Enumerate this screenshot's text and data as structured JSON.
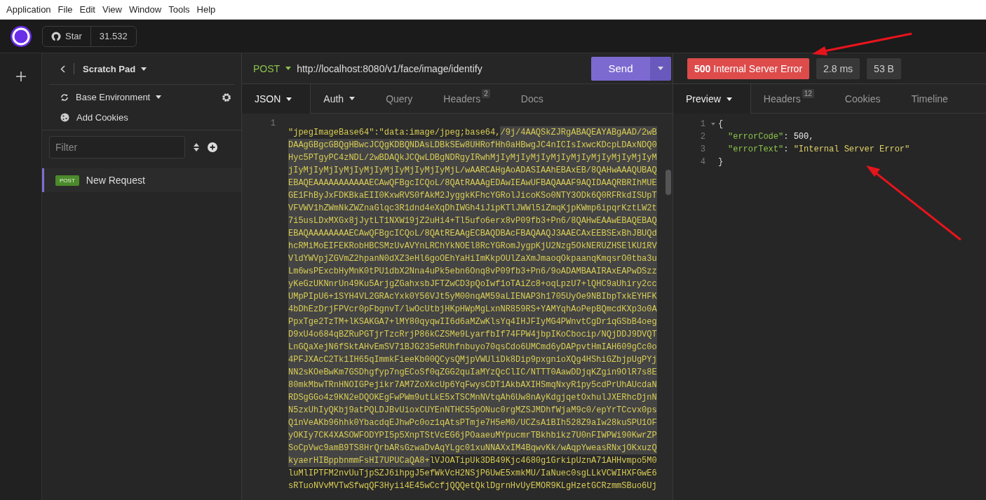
{
  "menu": [
    "Application",
    "File",
    "Edit",
    "View",
    "Window",
    "Tools",
    "Help"
  ],
  "github": {
    "label": "Star",
    "count": "31.532"
  },
  "sidebar": {
    "title": "Scratch Pad",
    "environment": "Base Environment",
    "cookies": "Add Cookies",
    "filter_placeholder": "Filter",
    "requests": [
      {
        "method": "POST",
        "name": "New Request",
        "selected": true
      }
    ]
  },
  "request": {
    "method": "POST",
    "url": "http://localhost:8080/v1/face/image/identify",
    "send": "Send",
    "tabs": [
      {
        "label": "JSON",
        "dropdown": true,
        "selected": true
      },
      {
        "label": "Auth",
        "dropdown": true,
        "selected": false
      },
      {
        "label": "Query",
        "dropdown": false,
        "selected": false
      },
      {
        "label": "Headers",
        "dropdown": false,
        "badge": "2",
        "selected": false
      },
      {
        "label": "Docs",
        "dropdown": false,
        "selected": false
      }
    ],
    "body": {
      "line_number": "1",
      "lines": [
        [
          {
            "text": "\"jpegImageBase64\":\"data:image/jpeg;base64,",
            "selected": false
          },
          {
            "text": "/9j/4AAQSkZJRgABAQEAYABgAAD/2wB",
            "selected": true
          }
        ],
        [
          {
            "text": "DAAgGBgcGBQgHBwcJCQgKDBQNDAsLDBkSEw8UHRofHh0aHBwgJC4nICIsIxwcKDcpLDAxNDQ0",
            "selected": true
          }
        ],
        [
          {
            "text": "Hyc5PTgyPC4zNDL/2wBDAQkJCQwLDBgNDRgyIRwhMjIyMjIyMjIyMjIyMjIyMjIyMjIyMjIyM",
            "selected": true
          }
        ],
        [
          {
            "text": "jIyMjIyMjIyMjIyMjIyMjIyMjIyMjIyMjL/wAARCAHgAoADASIAAhEBAxEB/8QAHwAAAQUBAQ",
            "selected": true
          }
        ],
        [
          {
            "text": "EBAQEAAAAAAAAAAAECAwQFBgcICQoL/8QAtRAAAgEDAwIEAwUFBAQAAAF9AQIDAAQRBRIhMUE",
            "selected": true
          }
        ],
        [
          {
            "text": "GE1FhByJxFDKBkaEII0KxwRVS0fAkM2JyggkKFhcYGRolJicoKSo0NTY3ODk6Q0RFRkdISUpT",
            "selected": true
          }
        ],
        [
          {
            "text": "VFVWV1hZWmNkZWZnaGlqc3R1dnd4eXqDhIWGh4iJipKTlJWWl5iZmqKjpKWmp6ipqrKztLW2t",
            "selected": true
          }
        ],
        [
          {
            "text": "7i5usLDxMXGx8jJytLT1NXW19jZ2uHi4+Tl5ufo6erx8vP09fb3+Pn6/8QAHwEAAwEBAQEBAQ",
            "selected": true
          }
        ],
        [
          {
            "text": "EBAQAAAAAAAAECAwQFBgcICQoL/8QAtREAAgECBAQDBAcFBAQAAQJ3AAECAxEEBSExBhJBUQd",
            "selected": true
          }
        ],
        [
          {
            "text": "hcRMiMoEIFEKRobHBCSMzUvAVYnLRChYkNOEl8RcYGRomJygpKjU2Nzg5OkNERUZHSElKU1RV",
            "selected": true
          }
        ],
        [
          {
            "text": "VldYWVpjZGVmZ2hpanN0dXZ3eHl6goOEhYaHiImKkpOUlZaXmJmaoqOkpaanqKmqsrO0tba3u",
            "selected": true
          }
        ],
        [
          {
            "text": "Lm6wsPExcbHyMnK0tPU1dbX2Nna4uPk5ebn6Onq8vP09fb3+Pn6/9oADAMBAAIRAxEAPwDSzz",
            "selected": true
          }
        ],
        [
          {
            "text": "yKeGzUKNnrUn49Ku5ArjgZGahxsbJFTZwCD3pQoIwf1oTAiZc8+oqLpzU7+lQHC9aUhiry2cc",
            "selected": true
          }
        ],
        [
          {
            "text": "UMpPIpU6+1SYH4VL2GRAcYxk0Y56VJt5yM00nqAM59aLIENAP3h1705UyOe9NBIbpTxkEYHFK",
            "selected": true
          }
        ],
        [
          {
            "text": "4bDhEzDrjFPVcr0pFbgnvT/lwOcUtbjHKpHWpMgLxnNR859RS+YAMYqhAoPepBQmcdKXp3o0A",
            "selected": true
          }
        ],
        [
          {
            "text": "PpxTge2TzTM+lKSAKGA7+lMY80qyqwII6d6aMZwKlsYq4IHJFIyMG4PWnvtCgDr1qGSbB4oeg",
            "selected": true
          }
        ],
        [
          {
            "text": "D9xU4o684qBZRuPGTjrTzcRrjP86kCZSMe9LyarfbIf74FPW4jbpIKoCbocip/NQjDDJ9DVQT",
            "selected": true
          }
        ],
        [
          {
            "text": "LnGQaXejN6fSktAHvEmSV71BJG235eRUhfnbuyo70qsCdo6UMCmd6yDAPpvtHmIAH609gCc0o",
            "selected": true
          }
        ],
        [
          {
            "text": "4PFJXAcC2Tk1IH65qImmkFieeKb00QCysQMjpVWUliDk8Dip9pxgnioXQg4HShiGZbjpUgPYj",
            "selected": true
          }
        ],
        [
          {
            "text": "NN2sKOeBwKm7GSDhgfyp7ngECoSf0qZGG2quIaMYzQcClIC/NTTT0AawDDjqKZgin9OlR7s8E",
            "selected": true
          }
        ],
        [
          {
            "text": "80mkMbwTRnHNOIGPejikr7AM7ZoXkcUp6YqFwysCDT1AkbAXIHSmqNxyR1py5cdPrUhAUcdaN",
            "selected": true
          }
        ],
        [
          {
            "text": "RDSgGGo4z9KN2eDQOKEgFwPWm9utLkE5xTSCMnNVtqAh6Uw8nAyKdgjqetOxhulJXERhcDjnN",
            "selected": true
          }
        ],
        [
          {
            "text": "N5zxUhIyQKbj9atPQLDJBvUioxCUYEnNTHC55pONuc0rgMZSJMDhfWjaM9c0/epYrTCcvx0ps",
            "selected": true
          }
        ],
        [
          {
            "text": "Q1nVeAKb96hhk0YbacdqEJhwPc0oz1qAtsPTmje7H5eM0/UCZsA1BIh528Z9aIw28kuSPU1OF",
            "selected": true
          }
        ],
        [
          {
            "text": "yOKIy7CK4XASOWFODYPI5p5XnpTStVcEG6jPOaaeuMYpucmrTBkhbikz7U0nFIWPWi90KwrZP",
            "selected": true
          }
        ],
        [
          {
            "text": "SoCpVwc9amB9TS8HrQrbARsGzwaDvAqYLgc01xuNNAXxIM4BqwvKk/wAqpYweasRNxjOKxuzQ",
            "selected": true
          }
        ],
        [
          {
            "text": "kyaerHIBppbnmmFsHI7UPUCaQA8+",
            "selected": true
          },
          {
            "text": "lVJOATipUk3DB49Kjc4680g1GrkipUznA71AHHvmpo5M0",
            "selected": false
          }
        ],
        [
          {
            "text": "luMlIPTFM2nvUuTjpSZJ6ihpgJ5efWkVcH2NSjP6UwE5xmkMU/IaNuec0sgLLkVCWIHXFGwE6",
            "selected": false
          }
        ],
        [
          {
            "text": "sRTuoNVvMVTwSfwqQF3Hyii4E45wCcfjQQQetQklDgrnHvUyEMOR9KLgHzetGCRzmmSBuo6Uj",
            "selected": false
          }
        ]
      ]
    }
  },
  "response": {
    "status_code": "500",
    "status_text": "Internal Server Error",
    "time": "2.8 ms",
    "size": "53 B",
    "tabs": [
      {
        "label": "Preview",
        "dropdown": true,
        "selected": true
      },
      {
        "label": "Headers",
        "dropdown": false,
        "badge": "12",
        "selected": false
      },
      {
        "label": "Cookies",
        "dropdown": false,
        "selected": false
      },
      {
        "label": "Timeline",
        "dropdown": false,
        "selected": false
      }
    ],
    "lines": [
      {
        "number": "1",
        "foldable": true,
        "indent": false,
        "tokens": [
          {
            "kind": "punct",
            "text": "{"
          }
        ]
      },
      {
        "number": "2",
        "foldable": false,
        "indent": true,
        "tokens": [
          {
            "kind": "key",
            "text": "\"errorCode\""
          },
          {
            "kind": "punct",
            "text": ": "
          },
          {
            "kind": "number",
            "text": "500"
          },
          {
            "kind": "punct",
            "text": ","
          }
        ]
      },
      {
        "number": "3",
        "foldable": false,
        "indent": true,
        "tokens": [
          {
            "kind": "key",
            "text": "\"errorText\""
          },
          {
            "kind": "punct",
            "text": ": "
          },
          {
            "kind": "string",
            "text": "\"Internal Server Error\""
          }
        ]
      },
      {
        "number": "4",
        "foldable": false,
        "indent": false,
        "tokens": [
          {
            "kind": "punct",
            "text": "}"
          }
        ]
      }
    ]
  }
}
